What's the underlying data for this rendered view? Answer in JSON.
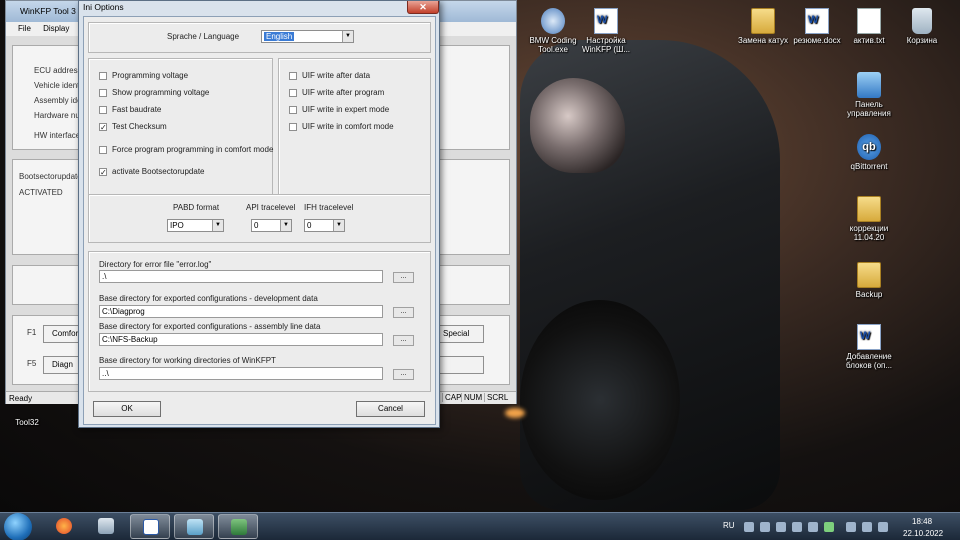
{
  "desktop": {
    "icons": [
      {
        "label": "BMW Coding Tool.exe",
        "icon": "bmw-icon"
      },
      {
        "label": "Настройка WinKFP (Ш...",
        "icon": "word-doc-icon"
      },
      {
        "label": "Замена катух",
        "icon": "folder-icon"
      },
      {
        "label": "резюме.docx",
        "icon": "word-doc-icon"
      },
      {
        "label": "актив.txt",
        "icon": "text-file-icon"
      },
      {
        "label": "Корзина",
        "icon": "recycle-bin-icon"
      },
      {
        "label": "Панель управления",
        "icon": "control-panel-icon"
      },
      {
        "label": "qBittorrent",
        "icon": "qbittorrent-icon"
      },
      {
        "label": "коррекции 11.04.20",
        "icon": "folder-icon"
      },
      {
        "label": "Backup",
        "icon": "folder-icon"
      },
      {
        "label": "Добавление блоков (оп...",
        "icon": "word-doc-icon"
      },
      {
        "label": "Tool32",
        "icon": "tool32-icon"
      }
    ]
  },
  "main_window": {
    "title": "WinKFP Tool 3",
    "menu": [
      "File",
      "Display"
    ],
    "labels": {
      "ecu": "ECU address",
      "vehicle": "Vehicle identi",
      "assembly": "Assembly ide",
      "hardware": "Hardware nu",
      "hw_interface": "HW interface",
      "bootsector": "Bootsectorupdate",
      "activated": "ACTIVATED",
      "f1": "F1",
      "f5": "F5"
    },
    "buttons": {
      "f1_btn": "Comfor",
      "f5_btn": "Diagn",
      "special_btn": "Special"
    },
    "status": {
      "text": "Ready",
      "cap": "CAP",
      "num": "NUM",
      "scrl": "SCRL"
    }
  },
  "dialog": {
    "title": "Ini Options",
    "close_glyph": "✕",
    "language_label": "Sprache / Language",
    "language_value": "English",
    "left_checks": [
      {
        "label": "Programming voltage",
        "checked": false
      },
      {
        "label": "Show programming voltage",
        "checked": false
      },
      {
        "label": "Fast baudrate",
        "checked": false
      },
      {
        "label": "Test Checksum",
        "checked": true
      },
      {
        "label": "Force program programming in comfort mode",
        "checked": false
      },
      {
        "label": "activate Bootsectorupdate",
        "checked": true
      }
    ],
    "right_checks": [
      {
        "label": "UIF write after data",
        "checked": false
      },
      {
        "label": "UIF write after program",
        "checked": false
      },
      {
        "label": "UIF write in expert mode",
        "checked": false
      },
      {
        "label": "UIF write in comfort mode",
        "checked": false
      }
    ],
    "pabd_label": "PABD format",
    "pabd_value": "IPO",
    "api_label": "API tracelevel",
    "api_value": "0",
    "ifh_label": "IFH tracelevel",
    "ifh_value": "0",
    "dirs": [
      {
        "label": "Directory for error file \"error.log\"",
        "value": ".\\"
      },
      {
        "label": "Base directory for exported configurations - development data",
        "value": "C:\\Diagprog"
      },
      {
        "label": "Base directory for exported configurations - assembly line data",
        "value": "C:\\NFS-Backup"
      },
      {
        "label": "Base directory for working directories of WinKFPT",
        "value": "..\\"
      }
    ],
    "browse_label": "...",
    "ok_label": "OK",
    "cancel_label": "Cancel"
  },
  "taskbar": {
    "apps": [
      "firefox-icon",
      "calculator-icon",
      "word-icon",
      "note-icon",
      "winkfp-icon"
    ],
    "lang": "RU",
    "time": "18:48",
    "date": "22.10.2022"
  }
}
